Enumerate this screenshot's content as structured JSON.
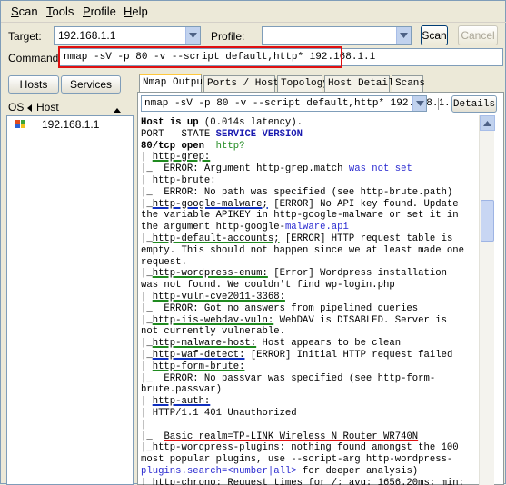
{
  "menu": [
    {
      "label": "Scan",
      "accel": "S"
    },
    {
      "label": "Tools",
      "accel": "T"
    },
    {
      "label": "Profile",
      "accel": "P"
    },
    {
      "label": "Help",
      "accel": "H"
    }
  ],
  "target": {
    "label": "Target:",
    "value": "192.168.1.1"
  },
  "profile": {
    "label": "Profile:",
    "value": ""
  },
  "buttons": {
    "scan": "Scan",
    "cancel": "Cancel"
  },
  "command": {
    "label": "Command:",
    "value": "nmap -sV -p 80 -v --script default,http* 192.168.1.1"
  },
  "left": {
    "hosts_button": "Hosts",
    "services_button": "Services",
    "os_label": "OS",
    "host_label": "Host",
    "hosts": [
      {
        "address": "192.168.1.1"
      }
    ]
  },
  "tabs": [
    "Nmap Output",
    "Ports / Hosts",
    "Topology",
    "Host Details",
    "Scans"
  ],
  "active_tab": 0,
  "output_selector": "nmap -sV -p 80 -v --script default,http* 192.168.1.1",
  "details_button": "Details",
  "scroll": {
    "position": 0.22,
    "visible_fraction": 0.12
  },
  "colors": {
    "accent_green": "#1f8a1f",
    "accent_blue": "#2a2ad0",
    "highlight_red": "#e01010"
  },
  "output": [
    {
      "type": "plain",
      "parts": [
        {
          "t": "Host is up",
          "s": "bold"
        },
        {
          "t": " (0.014s latency).",
          "s": "plain"
        }
      ]
    },
    {
      "type": "plain",
      "parts": [
        {
          "t": "PORT   STATE ",
          "s": "plain"
        },
        {
          "t": "SERVICE VERSION",
          "s": "navy"
        }
      ]
    },
    {
      "type": "plain",
      "parts": [
        {
          "t": "80/tcp open  ",
          "s": "bold"
        },
        {
          "t": "http?",
          "s": "green"
        }
      ]
    },
    {
      "type": "plain",
      "parts": [
        {
          "t": "| ",
          "s": "plain"
        },
        {
          "t": "http-grep:",
          "s": "ul-green"
        }
      ]
    },
    {
      "type": "plain",
      "parts": [
        {
          "t": "|_  ERROR: Argument http-grep.match ",
          "s": "plain"
        },
        {
          "t": "was not set",
          "s": "blue"
        }
      ]
    },
    {
      "type": "plain",
      "parts": [
        {
          "t": "| http-brute:",
          "s": "plain"
        }
      ]
    },
    {
      "type": "plain",
      "parts": [
        {
          "t": "|_  ERROR: No path was specified (see http-brute.path)",
          "s": "plain"
        }
      ]
    },
    {
      "type": "plain",
      "parts": [
        {
          "t": "|_",
          "s": "plain"
        },
        {
          "t": "http-google-malware;",
          "s": "ul-blue"
        },
        {
          "t": " [ERROR] No API key found. Update",
          "s": "plain"
        }
      ]
    },
    {
      "type": "plain",
      "parts": [
        {
          "t": "the variable APIKEY in http-google-malware or set it in",
          "s": "plain"
        }
      ]
    },
    {
      "type": "plain",
      "parts": [
        {
          "t": "the argument http-google-",
          "s": "plain"
        },
        {
          "t": "malware.api",
          "s": "blue"
        }
      ]
    },
    {
      "type": "plain",
      "parts": [
        {
          "t": "|_",
          "s": "plain"
        },
        {
          "t": "http-default-accounts;",
          "s": "ul-green"
        },
        {
          "t": " [ERROR] HTTP request table is",
          "s": "plain"
        }
      ]
    },
    {
      "type": "plain",
      "parts": [
        {
          "t": "empty. This should not happen since we at least made one",
          "s": "plain"
        }
      ]
    },
    {
      "type": "plain",
      "parts": [
        {
          "t": "request.",
          "s": "plain"
        }
      ]
    },
    {
      "type": "plain",
      "parts": [
        {
          "t": "|_",
          "s": "plain"
        },
        {
          "t": "http-wordpress-enum:",
          "s": "ul-green"
        },
        {
          "t": " [Error] Wordpress installation",
          "s": "plain"
        }
      ]
    },
    {
      "type": "plain",
      "parts": [
        {
          "t": "was not found. We couldn't find wp-login.php",
          "s": "plain"
        }
      ]
    },
    {
      "type": "plain",
      "parts": [
        {
          "t": "| ",
          "s": "plain"
        },
        {
          "t": "http-vuln-cve2011-3368:",
          "s": "ul-green"
        }
      ]
    },
    {
      "type": "plain",
      "parts": [
        {
          "t": "|_  ERROR: Got no answers from pipelined queries",
          "s": "plain"
        }
      ]
    },
    {
      "type": "plain",
      "parts": [
        {
          "t": "|_",
          "s": "plain"
        },
        {
          "t": "http-iis-webdav-vuln:",
          "s": "ul-green"
        },
        {
          "t": " WebDAV is DISABLED. Server is",
          "s": "plain"
        }
      ]
    },
    {
      "type": "plain",
      "parts": [
        {
          "t": "not currently vulnerable.",
          "s": "plain"
        }
      ]
    },
    {
      "type": "plain",
      "parts": [
        {
          "t": "|_",
          "s": "plain"
        },
        {
          "t": "http-malware-host:",
          "s": "ul-green"
        },
        {
          "t": " Host appears to be clean",
          "s": "plain"
        }
      ]
    },
    {
      "type": "plain",
      "parts": [
        {
          "t": "|_",
          "s": "plain"
        },
        {
          "t": "http-waf-detect:",
          "s": "ul-blue"
        },
        {
          "t": " [ERROR] Initial HTTP request failed",
          "s": "plain"
        }
      ]
    },
    {
      "type": "plain",
      "parts": [
        {
          "t": "| ",
          "s": "plain"
        },
        {
          "t": "http-form-brute:",
          "s": "ul-green"
        }
      ]
    },
    {
      "type": "plain",
      "parts": [
        {
          "t": "|_  ERROR: No passvar was specified (see http-form-",
          "s": "plain"
        }
      ]
    },
    {
      "type": "plain",
      "parts": [
        {
          "t": "brute.passvar)",
          "s": "plain"
        }
      ]
    },
    {
      "type": "plain",
      "parts": [
        {
          "t": "| ",
          "s": "plain"
        },
        {
          "t": "http-auth:",
          "s": "ul-blue"
        }
      ]
    },
    {
      "type": "plain",
      "parts": [
        {
          "t": "| HTTP/1.1 401 Unauthorized",
          "s": "plain"
        }
      ]
    },
    {
      "type": "plain",
      "parts": [
        {
          "t": "|",
          "s": "plain"
        }
      ]
    },
    {
      "type": "plain",
      "parts": [
        {
          "t": "|_  ",
          "s": "plain"
        },
        {
          "t": "Basic realm=TP-LINK Wireless N Router WR740N",
          "s": "ul-red"
        }
      ]
    },
    {
      "type": "plain",
      "parts": [
        {
          "t": "|_http-wordpress-plugins: nothing found amongst the 100",
          "s": "plain"
        }
      ]
    },
    {
      "type": "plain",
      "parts": [
        {
          "t": "most popular plugins, use --script-arg http-wordpress-",
          "s": "plain"
        }
      ]
    },
    {
      "type": "plain",
      "parts": [
        {
          "t": "plugins.search=<number|all>",
          "s": "blue"
        },
        {
          "t": " for deeper analysis)",
          "s": "plain"
        }
      ]
    },
    {
      "type": "plain",
      "parts": [
        {
          "t": "|_http-chrono: Request times for /; avg: 1656.20ms; min:",
          "s": "plain"
        }
      ]
    }
  ]
}
